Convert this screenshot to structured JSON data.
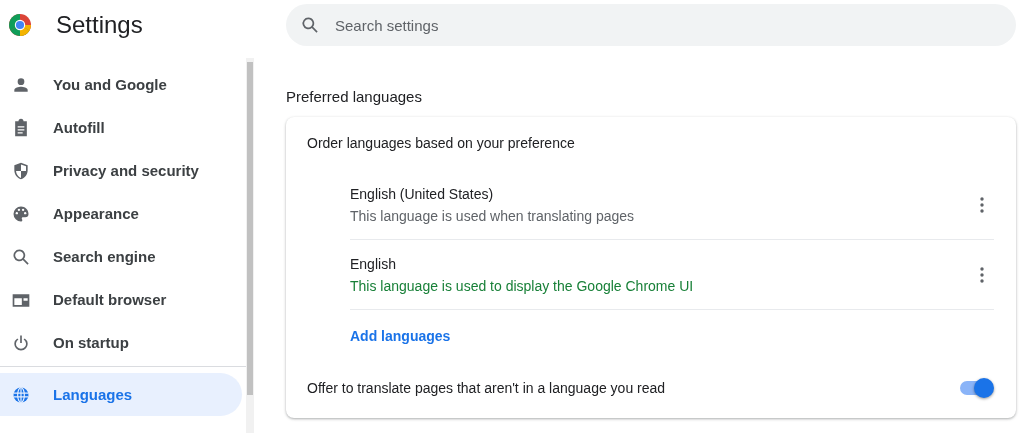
{
  "header": {
    "title": "Settings",
    "search": {
      "placeholder": "Search settings"
    }
  },
  "sidebar": {
    "sections": [
      [
        {
          "label": "You and Google",
          "selected": false
        },
        {
          "label": "Autofill",
          "selected": false
        },
        {
          "label": "Privacy and security",
          "selected": false
        },
        {
          "label": "Appearance",
          "selected": false
        },
        {
          "label": "Search engine",
          "selected": false
        },
        {
          "label": "Default browser",
          "selected": false
        },
        {
          "label": "On startup",
          "selected": false
        }
      ],
      [
        {
          "label": "Languages",
          "selected": true
        }
      ]
    ]
  },
  "section": {
    "title": "Preferred languages",
    "card": {
      "heading": "Order languages based on your preference",
      "languages": [
        {
          "name": "English (United States)",
          "description": "This language is used when translating pages",
          "ui_language": false
        },
        {
          "name": "English",
          "description": "This language is used to display the Google Chrome UI",
          "ui_language": true
        }
      ],
      "add_link": "Add languages",
      "translate_toggle": {
        "label": "Offer to translate pages that aren't in a language you read",
        "on": true
      }
    }
  }
}
